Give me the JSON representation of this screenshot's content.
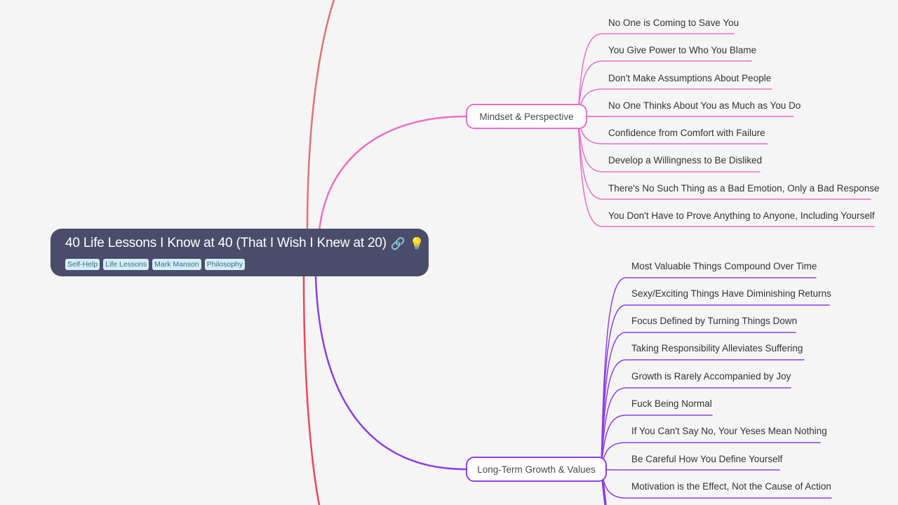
{
  "root": {
    "title": "40 Life Lessons I Know at 40 (That I Wish I Knew at 20)",
    "icons": [
      "link-icon",
      "lightbulb-icon"
    ],
    "link_glyph": "🔗",
    "bulb_glyph": "💡",
    "tags": [
      "Self-Help",
      "Life Lessons",
      "Mark Manson",
      "Philosophy"
    ]
  },
  "colors": {
    "background": "#f5f5f5",
    "root_fill": "#4a4d6a",
    "mindset_branch": "#ea6fc8",
    "growth_branch": "#8b3fe8",
    "top_branch_offscreen": "#e07272",
    "bottom_branch_offscreen": "#e8485a",
    "tag_fill": "#d4eef5",
    "tag_text": "#3d6b86"
  },
  "branches": [
    {
      "label": "Mindset & Perspective",
      "children": [
        "No One is Coming to Save You",
        "You Give Power to Who You Blame",
        "Don't Make Assumptions About People",
        "No One Thinks About You as Much as You Do",
        "Confidence from Comfort with Failure",
        "Develop a Willingness to Be Disliked",
        "There's No Such Thing as a Bad Emotion, Only a Bad Response",
        "You Don't Have to Prove Anything to Anyone, Including Yourself"
      ]
    },
    {
      "label": "Long-Term Growth & Values",
      "children": [
        "Most Valuable Things Compound Over Time",
        "Sexy/Exciting Things Have Diminishing Returns",
        "Focus Defined by Turning Things Down",
        "Taking Responsibility Alleviates Suffering",
        "Growth is Rarely Accompanied by Joy",
        "Fuck Being Normal",
        "If You Can't Say No, Your Yeses Mean Nothing",
        "Be Careful How You Define Yourself",
        "Motivation is the Effect, Not the Cause of Action"
      ]
    }
  ]
}
